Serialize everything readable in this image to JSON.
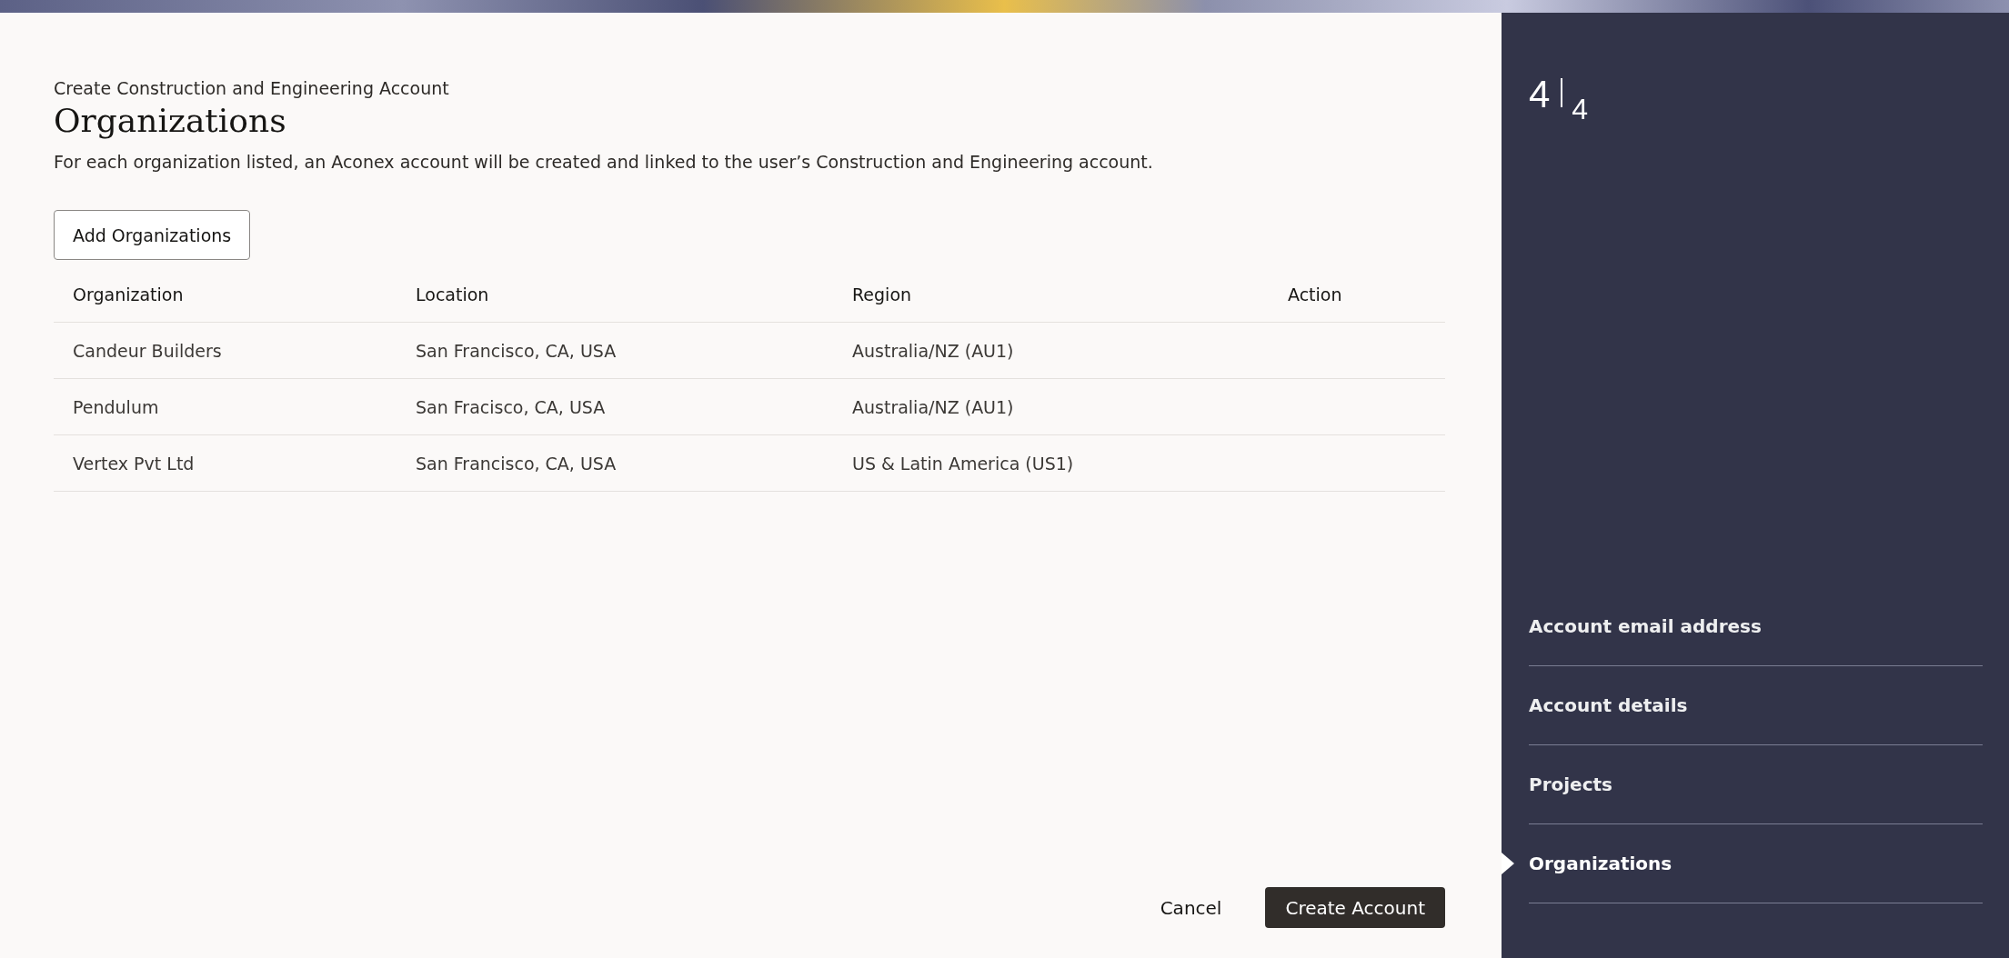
{
  "header": {
    "subtitle": "Create Construction and Engineering Account",
    "title": "Organizations",
    "description": "For each organization listed, an Aconex account will be created and linked to the user’s Construction and Engineering account."
  },
  "add_button": "Add Organizations",
  "table": {
    "columns": [
      "Organization",
      "Location",
      "Region",
      "Action"
    ],
    "rows": [
      [
        "Candeur Builders",
        "San Francisco, CA, USA",
        "Australia/NZ (AU1)"
      ],
      [
        "Pendulum",
        "San Fracisco, CA, USA",
        "Australia/NZ (AU1)"
      ],
      [
        "Vertex Pvt Ltd",
        "San Francisco, CA, USA",
        "US & Latin America (US1)"
      ]
    ]
  },
  "footer": {
    "cancel": "Cancel",
    "submit": "Create Account"
  },
  "sidebar": {
    "step": {
      "current": "4",
      "total": "4"
    },
    "items": [
      {
        "label": "Account email address",
        "selected": false
      },
      {
        "label": "Account details",
        "selected": false
      },
      {
        "label": "Projects",
        "selected": false
      },
      {
        "label": "Organizations",
        "selected": true
      }
    ]
  }
}
